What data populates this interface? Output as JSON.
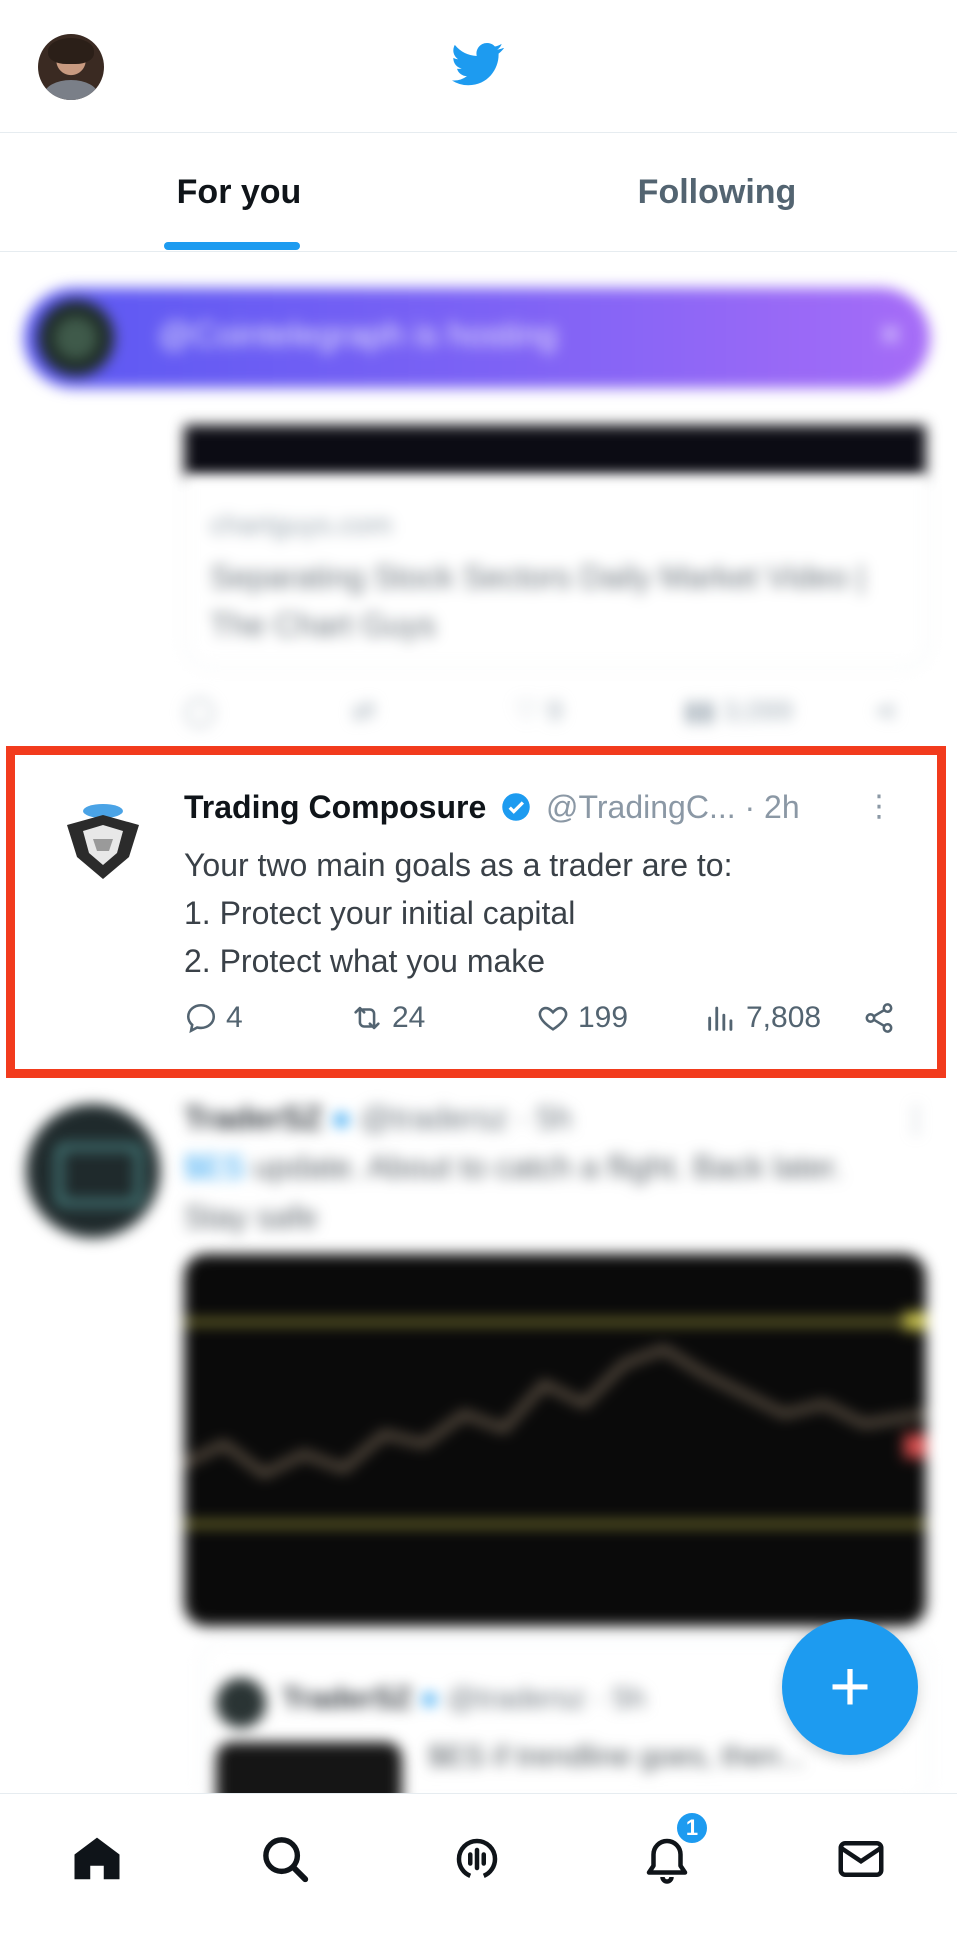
{
  "header": {
    "logo_icon": "twitter-bird-icon",
    "brand_color": "#1d9bf0",
    "profile_avatar": "user-avatar"
  },
  "tabs": [
    {
      "label": "For you",
      "active": true
    },
    {
      "label": "Following",
      "active": false
    }
  ],
  "spaces_banner": {
    "text": "@Cointelegraph is hosting",
    "close_icon": "close-icon"
  },
  "previous_tweet": {
    "card_domain": "chartguys.com",
    "card_title": "Separating Stock Sectors Daily Market Video | The Chart Guys",
    "likes": "9",
    "views": "3,099"
  },
  "focused_tweet": {
    "name": "Trading Composure",
    "handle": "@TradingC...",
    "time": "· 2h",
    "text_lines": [
      "Your two main goals as a trader are to:",
      "1. Protect your initial capital",
      "2. Protect what you make"
    ],
    "replies": "4",
    "retweets": "24",
    "likes": "199",
    "views": "7,808",
    "highlight_color": "#f23b1d"
  },
  "next_tweet": {
    "name": "TraderSZ",
    "handle": "@tradersz",
    "time": "· 5h",
    "text_tag": "$ES",
    "text_rest": " update. About to catch a flight. Back later. Stay safe",
    "quote": {
      "name": "TraderSZ",
      "handle": "@tradersz",
      "time": "· 5h",
      "text": "$ES if trendline goes, then..."
    }
  },
  "fab": {
    "label": "+"
  },
  "bottom_nav": {
    "items": [
      "home-icon",
      "search-icon",
      "spaces-icon",
      "notifications-icon",
      "messages-icon"
    ],
    "notification_count": "1"
  }
}
